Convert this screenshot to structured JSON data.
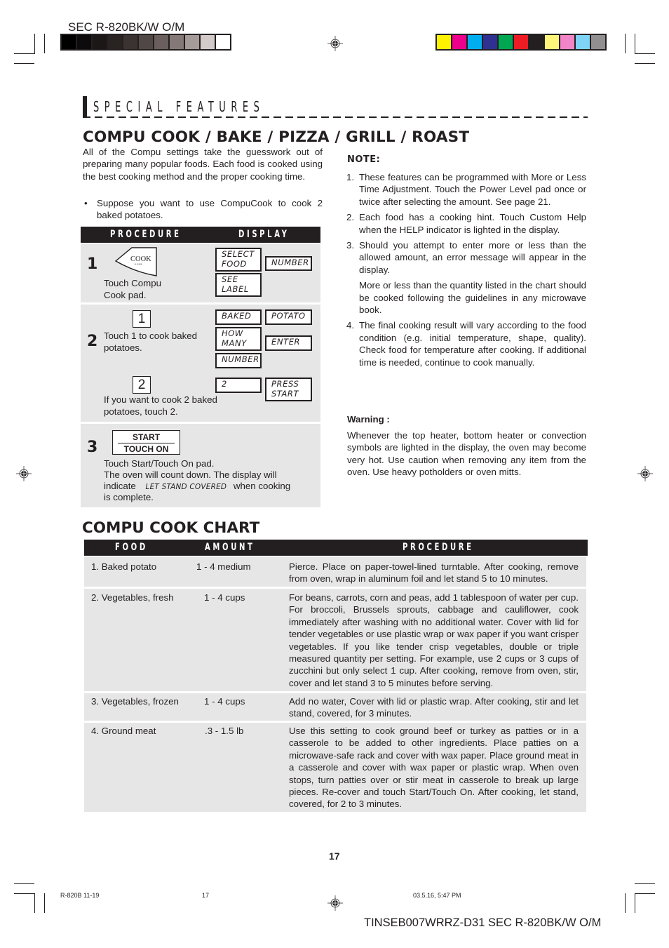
{
  "header": {
    "doc_code_top": "SEC R-820BK/W O/M",
    "gray_swatches": [
      "#000000",
      "#0d0b0b",
      "#1a1716",
      "#292321",
      "#3b3331",
      "#514846",
      "#6b5f5d",
      "#857977",
      "#a59b99",
      "#d3cbca",
      "#ffffff"
    ],
    "color_swatches": [
      "#fff200",
      "#ec008c",
      "#00aeef",
      "#2e3192",
      "#00a651",
      "#ed1c24",
      "#231f20",
      "#fff57a",
      "#f285c8",
      "#7fd3f7",
      "#918f8f"
    ]
  },
  "section_title": "SPECIAL FEATURES",
  "main_heading": "COMPU COOK / BAKE / PIZZA / GRILL / ROAST",
  "intro": {
    "paragraph": "All of the Compu settings take the guesswork out of preparing many popular foods. Each food is cooked using the best cooking method and the proper cooking time.",
    "bullet": "Suppose you want to use CompuCook to cook 2 baked potatoes."
  },
  "procedure_table": {
    "headers": {
      "procedure": "PROCEDURE",
      "display": "DISPLAY"
    },
    "steps": [
      {
        "number": "1",
        "pad_label": "COOK",
        "pad_dots": "••••",
        "text": "Touch Compu Cook pad.",
        "displays": [
          "SELECT FOOD",
          "NUMBER",
          "SEE LABEL"
        ]
      },
      {
        "number": "2",
        "key1": "1",
        "text1": "Touch 1 to cook baked potatoes.",
        "displays1": [
          "BAKED",
          "POTATO",
          "HOW MANY",
          "ENTER",
          "NUMBER"
        ],
        "key2": "2",
        "text2": "If you want to cook 2 baked potatoes, touch 2.",
        "displays2": [
          "2",
          "PRESS START"
        ]
      },
      {
        "number": "3",
        "pad_top": "START",
        "pad_bottom": "TOUCH ON",
        "text_a": "Touch Start/Touch On pad.",
        "text_b": "The oven will count down. The display will",
        "text_c_pre": "indicate",
        "text_c_lcd": "LET STAND COVERED",
        "text_c_post": "when cooking",
        "text_d": "is complete."
      }
    ]
  },
  "note": {
    "title": "NOTE:",
    "items": [
      {
        "n": "1.",
        "text": "These features can be programmed with More or Less Time Adjustment. Touch the Power Level pad once or twice after selecting the amount. See page 21."
      },
      {
        "n": "2.",
        "text": "Each food has a cooking hint. Touch Custom Help when the HELP indicator is lighted in the display."
      },
      {
        "n": "3.",
        "text": "Should you attempt to enter more or less than the allowed amount, an error message will appear in the display.",
        "extra": "More or less than the quantity listed in the chart should be cooked following the guidelines in any microwave book."
      },
      {
        "n": "4.",
        "text": "The final cooking result will vary according to the food condition (e.g. initial temperature, shape, quality). Check food for temperature after cooking. If additional time is needed, continue to cook manually."
      }
    ]
  },
  "warning": {
    "title": "Warning :",
    "text": "Whenever the top heater, bottom heater or convection symbols are lighted in the display, the oven may become very hot. Use caution when removing any item from the oven. Use heavy potholders or oven mitts."
  },
  "chart": {
    "title": "COMPU COOK CHART",
    "headers": {
      "food": "FOOD",
      "amount": "AMOUNT",
      "procedure": "PROCEDURE"
    },
    "rows": [
      {
        "food": "1. Baked potato",
        "amount": "1 - 4 medium",
        "procedure": "Pierce. Place on paper-towel-lined turntable. After cooking, remove from oven, wrap in aluminum foil and let stand 5 to 10 minutes."
      },
      {
        "food": "2. Vegetables, fresh",
        "amount": "1 - 4 cups",
        "procedure": "For beans, carrots, corn and peas, add 1 tablespoon of water per cup. For broccoli, Brussels sprouts, cabbage and cauliflower, cook immediately after washing with no additional water. Cover with lid for tender vegetables or use plastic wrap or wax paper if you want crisper vegetables. If you like tender crisp vegetables, double or triple measured quantity per setting. For example, use 2 cups or 3 cups of zucchini but only select 1 cup. After cooking, remove from oven, stir, cover and let stand 3 to 5 minutes before serving."
      },
      {
        "food": "3. Vegetables, frozen",
        "amount": "1 - 4 cups",
        "procedure": "Add no water, Cover with lid or plastic wrap. After cooking, stir and let stand, covered, for 3 minutes."
      },
      {
        "food": "4. Ground meat",
        "amount": ".3 - 1.5 lb",
        "procedure": "Use this setting to cook ground beef or turkey as patties or in a casserole to be added to other ingredients. Place patties on a microwave-safe rack and cover with wax paper. Place ground meat in a casserole and cover with wax paper or plastic wrap. When oven stops, turn patties over or stir meat in casserole to break up large pieces. Re-cover and touch Start/Touch On. After cooking, let stand, covered, for 2 to 3 minutes."
      }
    ]
  },
  "footer": {
    "page_number": "17",
    "slug_left": "R-820B 11-19",
    "slug_page": "17",
    "slug_date": "03.5.16, 5:47 PM",
    "doc_code_bottom": "TINSEB007WRRZ-D31 SEC R-820BK/W O/M"
  }
}
